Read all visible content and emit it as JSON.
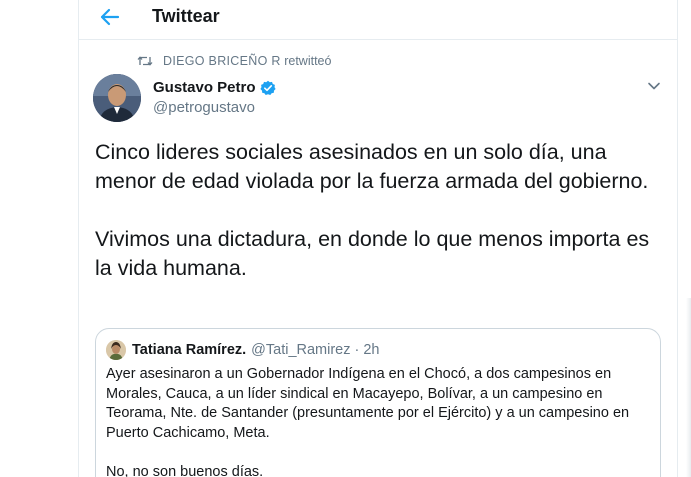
{
  "header": {
    "title": "Twittear"
  },
  "retweet": {
    "user": "DIEGO  BRICEÑO R",
    "action": "retwitteó"
  },
  "tweet": {
    "author_name": "Gustavo Petro",
    "author_handle": "@petrogustavo",
    "text": "Cinco lideres sociales asesinados en un solo día, una menor de edad violada por la fuerza armada del gobierno.\n\nVivimos una dictadura, en donde lo que menos importa es la vida humana."
  },
  "quote": {
    "author_name": "Tatiana Ramírez.",
    "author_handle": "@Tati_Ramirez",
    "separator": "·",
    "time": "2h",
    "text": "Ayer asesinaron a un Gobernador Indígena en el Chocó, a dos campesinos en Morales, Cauca, a un líder sindical en Macayepo, Bolívar, a un campesino en Teorama, Nte. de Santander (presuntamente por el Ejército) y a un campesino en Puerto Cachicamo, Meta.\n\nNo, no son buenos días."
  },
  "icons": {
    "back": "arrow-left-icon",
    "retweet": "retweet-icon",
    "verified": "verified-badge-icon",
    "more": "chevron-down-icon"
  },
  "colors": {
    "accent": "#1da1f2",
    "secondary_text": "#657786",
    "border": "#e6ecf0"
  }
}
